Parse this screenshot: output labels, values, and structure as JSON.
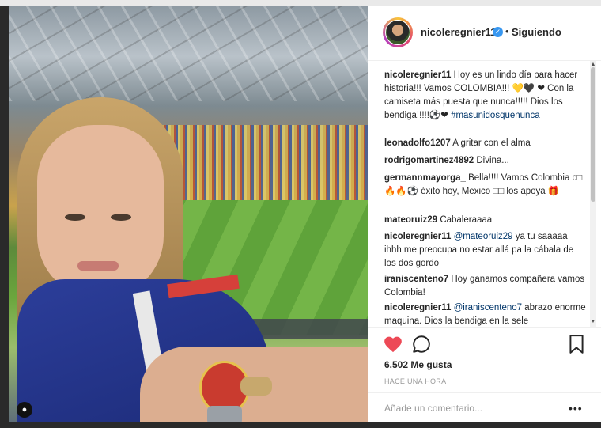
{
  "post": {
    "username": "nicoleregnier11",
    "separator": "•",
    "follow_status": "Siguiendo",
    "verified_icon": "verified-badge-icon",
    "user_tag_icon": "person-icon"
  },
  "comments": [
    {
      "author": "nicoleregnier11",
      "text": "Hoy es un lindo día para hacer historia!!! Vamos COLOMBIA!!! 💛🖤",
      "text2": "❤ Con la camiseta más puesta que nunca!!!!! Dios los bendiga!!!!!⚽❤",
      "hashtag": "#masunidosquenunca"
    },
    {
      "author": "leonadolfo1207",
      "text": "A gritar con el alma"
    },
    {
      "author": "rodrigomartinez4892",
      "text": "Divina..."
    },
    {
      "author": "germannmayorga_",
      "text": "Bella!!!! Vamos Colombia c□ 🔥🔥⚽ éxito hoy, Mexico □□ los apoya 🎁"
    },
    {
      "author": "mateoruiz29",
      "text": "Cabaleraaaa"
    },
    {
      "author": "nicoleregnier11",
      "mention": "@mateoruiz29",
      "text": "ya tu saaaaa ihhh me preocupa no estar allá pa la cábala de los dos gordo"
    },
    {
      "author": "iraniscenteno7",
      "text": "Hoy ganamos compañera vamos Colombia!"
    },
    {
      "author": "nicoleregnier11",
      "mention": "@iraniscenteno7",
      "text": "abrazo enorme maquina. Dios la bendiga en la sele"
    }
  ],
  "actions": {
    "like_icon": "heart-icon",
    "comment_icon": "speech-bubble-icon",
    "save_icon": "bookmark-icon",
    "likes": "6.502 Me gusta",
    "timestamp": "HACE UNA HORA"
  },
  "add_comment": {
    "placeholder": "Añade un comentario...",
    "more": "•••"
  },
  "colors": {
    "like_red": "#ed4956",
    "link_blue": "#003569",
    "verified_blue": "#3897f0",
    "text": "#262626",
    "muted": "#999999"
  }
}
